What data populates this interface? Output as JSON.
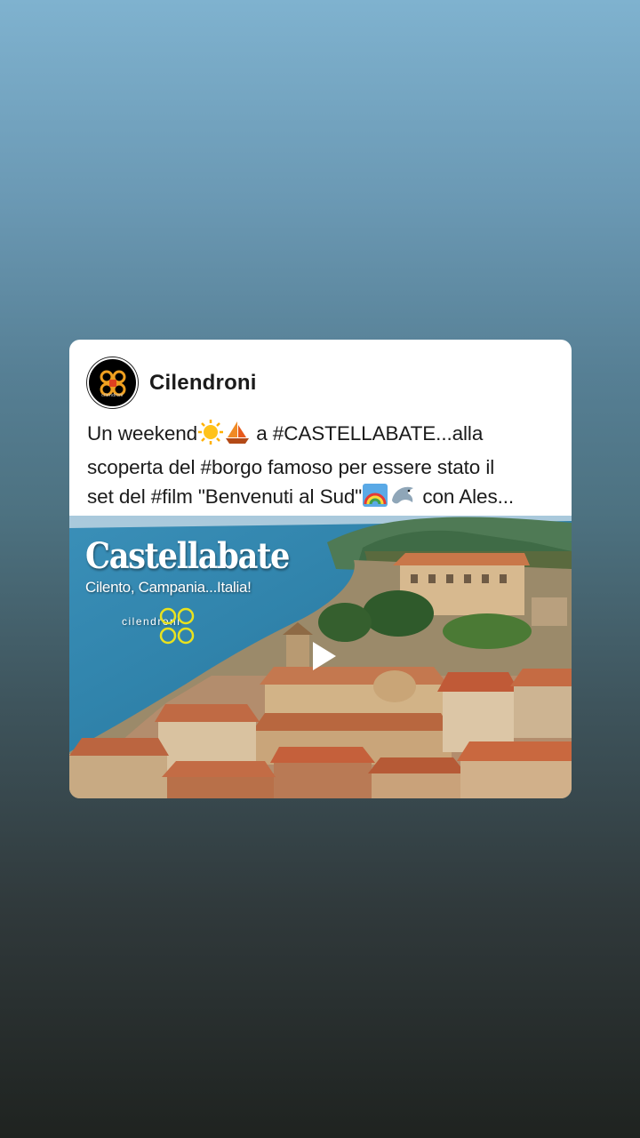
{
  "post": {
    "author": "Cilendroni",
    "avatar_label": "cilendroni",
    "text_lines": [
      {
        "before": "Un weekend",
        "after": " a #CASTELLABATE...alla"
      },
      {
        "text": "scoperta del #borgo famoso per essere stato il"
      },
      {
        "before": "set del #film \"Benvenuti al Sud\"",
        "after": " con Ales..."
      }
    ],
    "emojis": [
      "sun-icon",
      "sailboat-icon",
      "rainbow-icon",
      "dolphin-icon"
    ]
  },
  "media": {
    "type": "video",
    "title": "Castellabate",
    "subtitle": "Cilento, Campania...Italia!",
    "brand": "cilendroni",
    "play_icon": "play-icon"
  },
  "colors": {
    "card_background": "#ffffff",
    "text": "#1b1b1b",
    "sea": "#2f86b0",
    "roof": "#c9744a",
    "brand_logo": "#e9e21f"
  }
}
